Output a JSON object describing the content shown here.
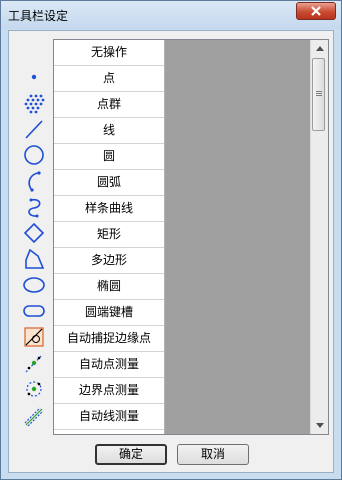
{
  "window": {
    "title": "工具栏设定",
    "close_icon": "close-icon"
  },
  "toolbar_items": [
    {
      "label": "无操作",
      "icon": "none"
    },
    {
      "label": "点",
      "icon": "point-icon"
    },
    {
      "label": "点群",
      "icon": "point-cloud-icon"
    },
    {
      "label": "线",
      "icon": "line-icon"
    },
    {
      "label": "圆",
      "icon": "circle-icon"
    },
    {
      "label": "圆弧",
      "icon": "arc-icon"
    },
    {
      "label": "样条曲线",
      "icon": "spline-icon"
    },
    {
      "label": "矩形",
      "icon": "rectangle-icon"
    },
    {
      "label": "多边形",
      "icon": "polygon-icon"
    },
    {
      "label": "椭圆",
      "icon": "ellipse-icon"
    },
    {
      "label": "圆端键槽",
      "icon": "slot-icon"
    },
    {
      "label": "自动捕捉边缘点",
      "icon": "edge-snap-icon"
    },
    {
      "label": "自动点测量",
      "icon": "auto-point-measure-icon"
    },
    {
      "label": "边界点测量",
      "icon": "boundary-point-measure-icon"
    },
    {
      "label": "自动线测量",
      "icon": "auto-line-measure-icon"
    }
  ],
  "buttons": {
    "ok": "确定",
    "cancel": "取消"
  },
  "colors": {
    "icon_blue": "#1e4fd6",
    "title_bar": "#c4d8ee",
    "close_red": "#c94b32",
    "list_background": "#a0a0a0"
  }
}
